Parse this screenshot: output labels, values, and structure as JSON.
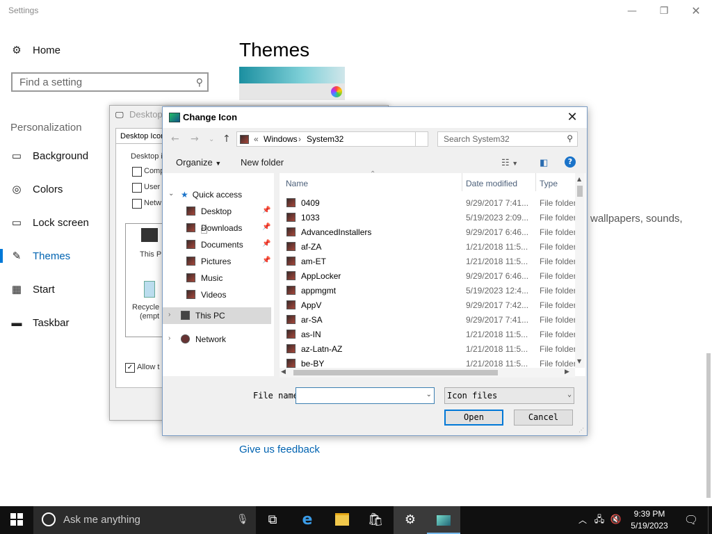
{
  "settings": {
    "window_title": "Settings",
    "home_label": "Home",
    "search_placeholder": "Find a setting",
    "section_label": "Personalization",
    "nav": [
      {
        "label": "Background",
        "icon": "image-icon"
      },
      {
        "label": "Colors",
        "icon": "palette-icon"
      },
      {
        "label": "Lock screen",
        "icon": "lock-screen-icon"
      },
      {
        "label": "Themes",
        "icon": "themes-icon",
        "selected": true
      },
      {
        "label": "Start",
        "icon": "start-icon"
      },
      {
        "label": "Taskbar",
        "icon": "taskbar-icon"
      }
    ],
    "page_title": "Themes",
    "background_desc": "wallpapers, sounds,",
    "feedback_link": "Give us feedback",
    "accent_color": "#0078d7"
  },
  "desktop_icon_dialog": {
    "title": "Desktop",
    "tab": "Desktop Icon",
    "group_label": "Desktop i",
    "checks": [
      "Comp",
      "User",
      "Netw"
    ],
    "icons": [
      "This P",
      "Recycle",
      "(empt"
    ],
    "allow": "Allow t"
  },
  "change_icon": {
    "title": "Change Icon",
    "breadcrumb": [
      "Windows",
      "System32"
    ],
    "search_placeholder": "Search System32",
    "organize": "Organize",
    "new_folder": "New folder",
    "nav_tree": [
      {
        "label": "Quick access"
      },
      {
        "label": "Desktop",
        "pinned": true
      },
      {
        "label": "Downloads",
        "pinned": true
      },
      {
        "label": "Documents",
        "pinned": true
      },
      {
        "label": "Pictures",
        "pinned": true
      },
      {
        "label": "Music"
      },
      {
        "label": "Videos"
      },
      {
        "label": "This PC",
        "selected": true
      },
      {
        "label": "Network"
      }
    ],
    "columns": [
      "Name",
      "Date modified",
      "Type"
    ],
    "files": [
      {
        "name": "0409",
        "date": "9/29/2017 7:41...",
        "type": "File folder"
      },
      {
        "name": "1033",
        "date": "5/19/2023 2:09...",
        "type": "File folder"
      },
      {
        "name": "AdvancedInstallers",
        "date": "9/29/2017 6:46...",
        "type": "File folder"
      },
      {
        "name": "af-ZA",
        "date": "1/21/2018 11:5...",
        "type": "File folder"
      },
      {
        "name": "am-ET",
        "date": "1/21/2018 11:5...",
        "type": "File folder"
      },
      {
        "name": "AppLocker",
        "date": "9/29/2017 6:46...",
        "type": "File folder"
      },
      {
        "name": "appmgmt",
        "date": "5/19/2023 12:4...",
        "type": "File folder"
      },
      {
        "name": "AppV",
        "date": "9/29/2017 7:42...",
        "type": "File folder"
      },
      {
        "name": "ar-SA",
        "date": "9/29/2017 7:41...",
        "type": "File folder"
      },
      {
        "name": "as-IN",
        "date": "1/21/2018 11:5...",
        "type": "File folder"
      },
      {
        "name": "az-Latn-AZ",
        "date": "1/21/2018 11:5...",
        "type": "File folder"
      },
      {
        "name": "be-BY",
        "date": "1/21/2018 11:5...",
        "type": "File folder"
      }
    ],
    "file_name_label": "File name:",
    "file_name_value": "",
    "file_type": "Icon files",
    "open_label": "Open",
    "cancel_label": "Cancel"
  },
  "taskbar": {
    "search_placeholder": "Ask me anything",
    "time": "9:39 PM",
    "date": "5/19/2023"
  }
}
